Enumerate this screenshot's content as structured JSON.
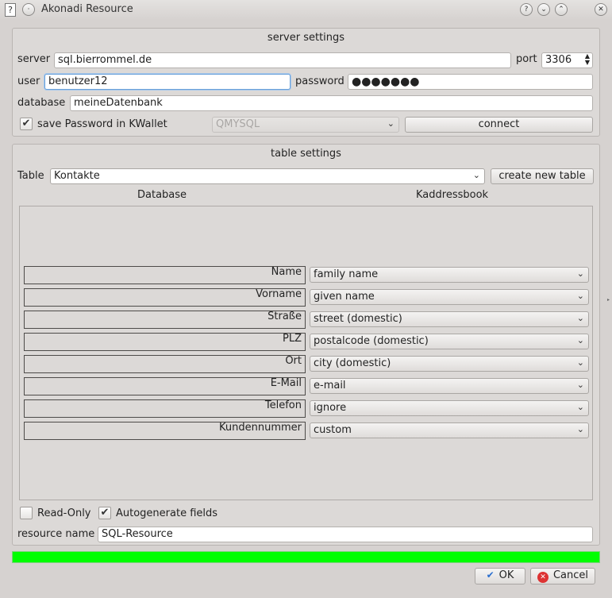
{
  "window": {
    "title": "Akonadi Resource",
    "help_btn": "?",
    "minimize_btn": "⌄",
    "maximize_btn": "⌃",
    "close_btn": "✕"
  },
  "server": {
    "group_title": "server settings",
    "server_label": "server",
    "server_value": "sql.bierrommel.de",
    "port_label": "port",
    "port_value": "3306",
    "user_label": "user",
    "user_value": "benutzer12",
    "password_label": "password",
    "password_value": "●●●●●●●",
    "database_label": "database",
    "database_value": "meineDatenbank",
    "save_password_label": "save Password in KWallet",
    "save_password_checked": true,
    "driver_value": "QMYSQL",
    "connect_label": "connect"
  },
  "table": {
    "group_title": "table settings",
    "table_label": "Table",
    "table_value": "Kontakte",
    "create_table_label": "create new table",
    "col_database": "Database",
    "col_kaddressbook": "Kaddressbook",
    "mappings": [
      {
        "field": "Name",
        "target": "family name"
      },
      {
        "field": "Vorname",
        "target": "given name"
      },
      {
        "field": "Straße",
        "target": "street (domestic)"
      },
      {
        "field": "PLZ",
        "target": "postalcode (domestic)"
      },
      {
        "field": "Ort",
        "target": "city (domestic)"
      },
      {
        "field": "E-Mail",
        "target": "e-mail"
      },
      {
        "field": "Telefon",
        "target": "ignore"
      },
      {
        "field": "Kundennummer",
        "target": "custom"
      }
    ]
  },
  "options": {
    "readonly_label": "Read-Only",
    "readonly_checked": false,
    "autogenerate_label": "Autogenerate fields",
    "autogenerate_checked": true,
    "resource_name_label": "resource name",
    "resource_name_value": "SQL-Resource"
  },
  "status": {
    "progress": 1.0,
    "progress_color": "#00ff00"
  },
  "buttons": {
    "ok": "OK",
    "cancel": "Cancel"
  }
}
